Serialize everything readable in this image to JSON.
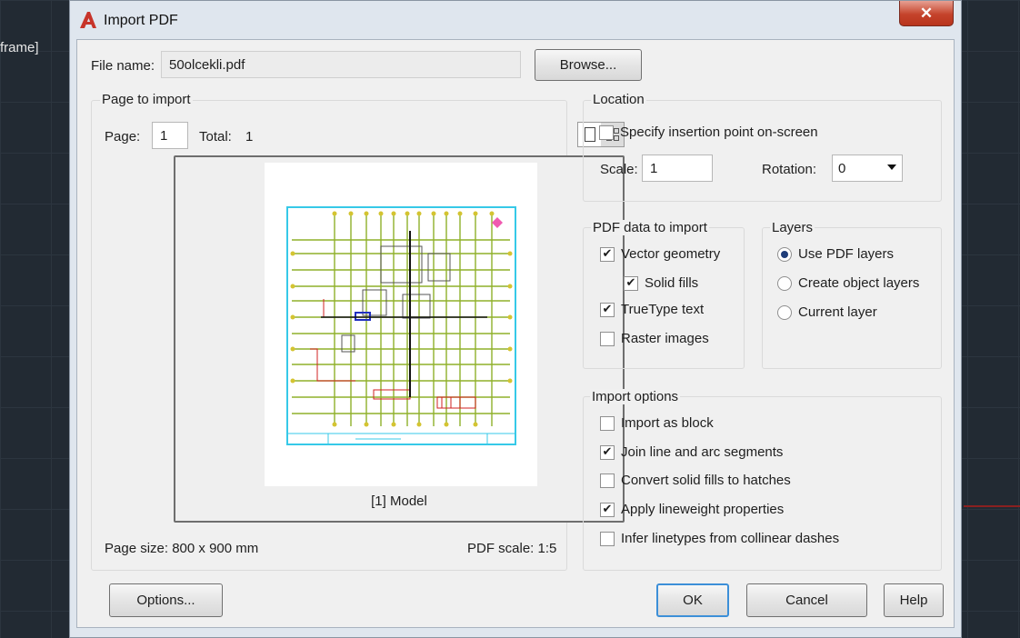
{
  "background": {
    "label": "frame]"
  },
  "window": {
    "title": "Import PDF",
    "close_glyph": "✕"
  },
  "file": {
    "label": "File name:",
    "value": "50olcekli.pdf",
    "browse_label": "Browse..."
  },
  "page_to_import": {
    "title": "Page to import",
    "page_label": "Page:",
    "page_value": "1",
    "total_label": "Total:",
    "total_value": "1",
    "preview_caption": "[1] Model",
    "page_size": "Page size: 800 x 900 mm",
    "pdf_scale": "PDF scale: 1:5"
  },
  "location": {
    "title": "Location",
    "specify_insertion": {
      "label": "Specify insertion point on-screen",
      "checked": false
    },
    "scale_label": "Scale:",
    "scale_value": "1",
    "rotation_label": "Rotation:",
    "rotation_value": "0"
  },
  "pdf_data": {
    "title": "PDF data to import",
    "items": [
      {
        "label": "Vector geometry",
        "checked": true
      },
      {
        "label": "Solid fills",
        "checked": true
      },
      {
        "label": "TrueType text",
        "checked": true
      },
      {
        "label": "Raster images",
        "checked": false
      }
    ]
  },
  "layers": {
    "title": "Layers",
    "options": [
      {
        "label": "Use PDF layers",
        "selected": true
      },
      {
        "label": "Create object layers",
        "selected": false
      },
      {
        "label": "Current layer",
        "selected": false
      }
    ]
  },
  "import_options": {
    "title": "Import options",
    "items": [
      {
        "label": "Import as block",
        "checked": false
      },
      {
        "label": "Join line and arc segments",
        "checked": true
      },
      {
        "label": "Convert solid fills to hatches",
        "checked": false
      },
      {
        "label": "Apply lineweight properties",
        "checked": true
      },
      {
        "label": "Infer linetypes from collinear dashes",
        "checked": false
      }
    ]
  },
  "buttons": {
    "options": "Options...",
    "ok": "OK",
    "cancel": "Cancel",
    "help": "Help"
  },
  "colors": {
    "accent": "#3c8fd8",
    "title_icon": "#c7342a",
    "close": "#c5432b"
  },
  "icons": [
    "autocad-a-icon",
    "close-icon",
    "single-page-icon",
    "thumbnail-grid-icon",
    "dropdown-arrow-icon"
  ]
}
